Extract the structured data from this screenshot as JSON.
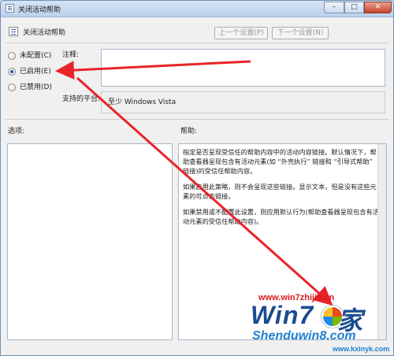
{
  "window": {
    "title": "关闭活动帮助",
    "controls": {
      "minimize": "–",
      "maximize": "□",
      "close": "✕"
    }
  },
  "header": {
    "policy_name": "关闭活动帮助",
    "prev_setting": "上一个设置(P)",
    "next_setting": "下一个设置(N)"
  },
  "options": {
    "not_configured": "未配置(C)",
    "enabled": "已启用(E)",
    "disabled": "已禁用(D)",
    "selected": "enabled"
  },
  "comment": {
    "label": "注释:",
    "value": ""
  },
  "supported": {
    "label": "支持的平台:",
    "value": "至少 Windows Vista"
  },
  "sections": {
    "options_label": "选项:",
    "help_label": "帮助:"
  },
  "help_text": {
    "p1": "指定是否呈现受信任的帮助内容中的活动内容链接。默认情况下，帮助查看器呈现包含有活动元素(如 “外壳执行” 链接和 “引导式帮助” 链接)的受信任帮助内容。",
    "p2": "如果启用此策略，则不会呈现这些链接。显示文本，但是没有这些元素的可点击链接。",
    "p3": "如果禁用或不配置此设置，则应用默认行为(帮助查看器呈现包含有活动元素的受信任帮助内容)。"
  },
  "watermark": {
    "url_top": "www.win7zhijia.cn",
    "logo_a": "Win7",
    "logo_b": "家",
    "site": "Shenduwin8.com",
    "url_bottom": "www.kxinyk.com"
  },
  "colors": {
    "arrow": "#e8242a",
    "accent": "#1a5ab0"
  },
  "icons": {
    "title": "policy-document-icon",
    "header": "policy-document-icon"
  }
}
